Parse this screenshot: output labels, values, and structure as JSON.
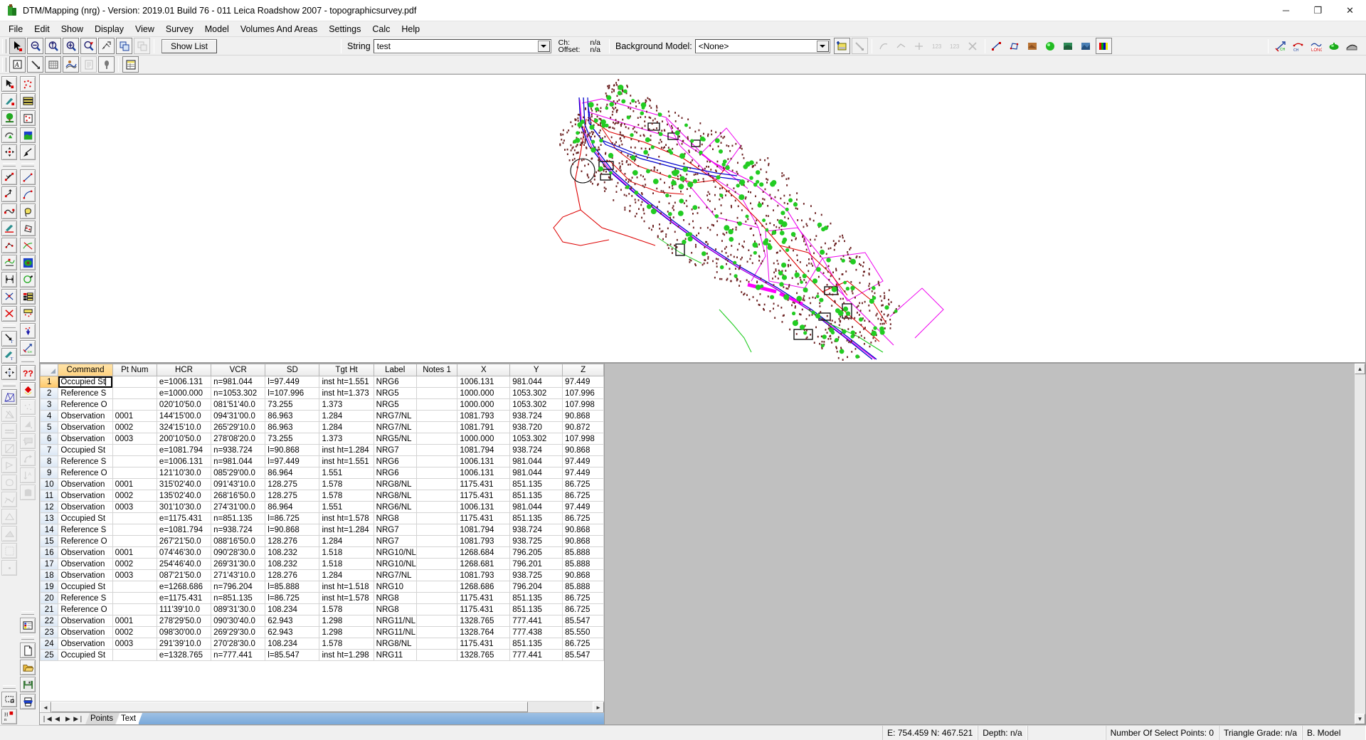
{
  "window": {
    "title": "DTM/Mapping (nrg) - Version: 2019.01 Build 76 - 011 Leica Roadshow 2007 - topographicsurvey.pdf",
    "app_icon": "survey-app-icon",
    "minimize": "─",
    "maximize": "❐",
    "close": "✕"
  },
  "menu": [
    {
      "label": "File"
    },
    {
      "label": "Edit"
    },
    {
      "label": "Show"
    },
    {
      "label": "Display"
    },
    {
      "label": "View"
    },
    {
      "label": "Survey"
    },
    {
      "label": "Model"
    },
    {
      "label": "Volumes And Areas"
    },
    {
      "label": "Settings"
    },
    {
      "label": "Calc"
    },
    {
      "label": "Help"
    }
  ],
  "toolbar": {
    "show_list_label": "Show List",
    "string_label": "String",
    "string_value": "test",
    "ch_label": "Ch:",
    "offset_label": "Offset:",
    "ch_value": "n/a",
    "offset_value": "n/a",
    "background_model_label": "Background Model:",
    "background_model_value": "<None>",
    "icons_row1": [
      "select-arrow-icon",
      "zoom-out-icon",
      "zoom-window-icon",
      "zoom-in-icon",
      "zoom-pan-icon",
      "zoom-extents-icon",
      "tile-windows-icon",
      "cascade-windows-icon"
    ],
    "icons_row2": [
      "text-annotate-icon",
      "pointer-line-icon",
      "grid-icon",
      "contours-icon",
      "report-icon",
      "marker-icon",
      "table-view-icon"
    ],
    "icons_right": [
      "pick-image-icon",
      "pointer-pick-icon",
      "string-edit-icon",
      "string-join-icon",
      "renumber-icon",
      "delete-cross-icon",
      "string-split-icon",
      "polygon-tool-icon",
      "surface-icon",
      "shade-icon",
      "palette-icon",
      "chainage-icon",
      "offset-chainage-icon",
      "long-section-icon",
      "volume-icon",
      "section-icon"
    ]
  },
  "left_toolbar_col1": [
    "select-point-icon",
    "wand-point-icon",
    "tree-point-icon",
    "arc-point-icon",
    "move-point-icon",
    "add-line-point-icon",
    "raise-point-icon",
    "smooth-line-icon",
    "wand-line-icon",
    "points-line-icon",
    "breakline-icon",
    "offset-line-icon",
    "cross-line-icon",
    "delete-line-icon",
    "text-arrow-icon",
    "text-wand-icon",
    "move-text-icon",
    "triangulate-icon",
    "delete-triangle-icon",
    "contour-line-icon",
    "diagonal-swap-icon",
    "flag-triangle-icon",
    "boundary-icon",
    "mesh-edit-icon",
    "hull-icon",
    "shade-triangle-icon",
    "dither-icon",
    "single-point-icon",
    "rectangle-area-icon",
    "volume-area-icon"
  ],
  "left_toolbar_col2": [
    "scatter-points-icon",
    "table-points-icon",
    "box-points-icon",
    "map-fill-icon",
    "pick-arrow-icon",
    "line-points-icon",
    "curve-points-icon",
    "lasso-icon",
    "polygon-points-icon",
    "cross-strings-icon",
    "shaded-model-icon",
    "tree-edit-icon",
    "legend-icon",
    "report-points-icon",
    "station-icon",
    "chainage-arrow-icon",
    "query-icon",
    "paint-bucket-icon",
    "sparse-points-icon",
    "wedge-icon",
    "label-box-icon",
    "rotate-icon",
    "sort-az-icon",
    "fill-shape-icon",
    "properties-icon",
    "new-file-icon",
    "open-file-icon",
    "save-file-icon",
    "print-icon"
  ],
  "grid": {
    "columns": [
      "Command",
      "Pt Num",
      "HCR",
      "VCR",
      "SD",
      "Tgt Ht",
      "Label",
      "Notes 1",
      "X",
      "Y",
      "Z"
    ],
    "active_cell": {
      "row": 1,
      "column": "Command",
      "value": "Occupied St"
    },
    "rows": [
      {
        "n": "1",
        "cells": [
          "Occupied St",
          "",
          "e=1006.131",
          "n=981.044",
          "l=97.449",
          "inst ht=1.551",
          "NRG6",
          "",
          "1006.131",
          "981.044",
          "97.449"
        ]
      },
      {
        "n": "2",
        "cells": [
          "Reference S",
          "",
          "e=1000.000",
          "n=1053.302",
          "l=107.996",
          "inst ht=1.373",
          "NRG5",
          "",
          "1000.000",
          "1053.302",
          "107.996"
        ]
      },
      {
        "n": "3",
        "cells": [
          "Reference O",
          "",
          "020'10'50.0",
          "081'51'40.0",
          "73.255",
          "1.373",
          "NRG5",
          "",
          "1000.000",
          "1053.302",
          "107.998"
        ]
      },
      {
        "n": "4",
        "cells": [
          "Observation",
          "0001",
          "144'15'00.0",
          "094'31'00.0",
          "86.963",
          "1.284",
          "NRG7/NL",
          "",
          "1081.793",
          "938.724",
          "90.868"
        ]
      },
      {
        "n": "5",
        "cells": [
          "Observation",
          "0002",
          "324'15'10.0",
          "265'29'10.0",
          "86.963",
          "1.284",
          "NRG7/NL",
          "",
          "1081.791",
          "938.720",
          "90.872"
        ]
      },
      {
        "n": "6",
        "cells": [
          "Observation",
          "0003",
          "200'10'50.0",
          "278'08'20.0",
          "73.255",
          "1.373",
          "NRG5/NL",
          "",
          "1000.000",
          "1053.302",
          "107.998"
        ]
      },
      {
        "n": "7",
        "cells": [
          "Occupied St",
          "",
          "e=1081.794",
          "n=938.724",
          "l=90.868",
          "inst ht=1.284",
          "NRG7",
          "",
          "1081.794",
          "938.724",
          "90.868"
        ]
      },
      {
        "n": "8",
        "cells": [
          "Reference S",
          "",
          "e=1006.131",
          "n=981.044",
          "l=97.449",
          "inst ht=1.551",
          "NRG6",
          "",
          "1006.131",
          "981.044",
          "97.449"
        ]
      },
      {
        "n": "9",
        "cells": [
          "Reference O",
          "",
          "121'10'30.0",
          "085'29'00.0",
          "86.964",
          "1.551",
          "NRG6",
          "",
          "1006.131",
          "981.044",
          "97.449"
        ]
      },
      {
        "n": "10",
        "cells": [
          "Observation",
          "0001",
          "315'02'40.0",
          "091'43'10.0",
          "128.275",
          "1.578",
          "NRG8/NL",
          "",
          "1175.431",
          "851.135",
          "86.725"
        ]
      },
      {
        "n": "11",
        "cells": [
          "Observation",
          "0002",
          "135'02'40.0",
          "268'16'50.0",
          "128.275",
          "1.578",
          "NRG8/NL",
          "",
          "1175.431",
          "851.135",
          "86.725"
        ]
      },
      {
        "n": "12",
        "cells": [
          "Observation",
          "0003",
          "301'10'30.0",
          "274'31'00.0",
          "86.964",
          "1.551",
          "NRG6/NL",
          "",
          "1006.131",
          "981.044",
          "97.449"
        ]
      },
      {
        "n": "13",
        "cells": [
          "Occupied St",
          "",
          "e=1175.431",
          "n=851.135",
          "l=86.725",
          "inst ht=1.578",
          "NRG8",
          "",
          "1175.431",
          "851.135",
          "86.725"
        ]
      },
      {
        "n": "14",
        "cells": [
          "Reference S",
          "",
          "e=1081.794",
          "n=938.724",
          "l=90.868",
          "inst ht=1.284",
          "NRG7",
          "",
          "1081.794",
          "938.724",
          "90.868"
        ]
      },
      {
        "n": "15",
        "cells": [
          "Reference O",
          "",
          "267'21'50.0",
          "088'16'50.0",
          "128.276",
          "1.284",
          "NRG7",
          "",
          "1081.793",
          "938.725",
          "90.868"
        ]
      },
      {
        "n": "16",
        "cells": [
          "Observation",
          "0001",
          "074'46'30.0",
          "090'28'30.0",
          "108.232",
          "1.518",
          "NRG10/NL",
          "",
          "1268.684",
          "796.205",
          "85.888"
        ]
      },
      {
        "n": "17",
        "cells": [
          "Observation",
          "0002",
          "254'46'40.0",
          "269'31'30.0",
          "108.232",
          "1.518",
          "NRG10/NL",
          "",
          "1268.681",
          "796.201",
          "85.888"
        ]
      },
      {
        "n": "18",
        "cells": [
          "Observation",
          "0003",
          "087'21'50.0",
          "271'43'10.0",
          "128.276",
          "1.284",
          "NRG7/NL",
          "",
          "1081.793",
          "938.725",
          "90.868"
        ]
      },
      {
        "n": "19",
        "cells": [
          "Occupied St",
          "",
          "e=1268.686",
          "n=796.204",
          "l=85.888",
          "inst ht=1.518",
          "NRG10",
          "",
          "1268.686",
          "796.204",
          "85.888"
        ]
      },
      {
        "n": "20",
        "cells": [
          "Reference S",
          "",
          "e=1175.431",
          "n=851.135",
          "l=86.725",
          "inst ht=1.578",
          "NRG8",
          "",
          "1175.431",
          "851.135",
          "86.725"
        ]
      },
      {
        "n": "21",
        "cells": [
          "Reference O",
          "",
          "111'39'10.0",
          "089'31'30.0",
          "108.234",
          "1.578",
          "NRG8",
          "",
          "1175.431",
          "851.135",
          "86.725"
        ]
      },
      {
        "n": "22",
        "cells": [
          "Observation",
          "0001",
          "278'29'50.0",
          "090'30'40.0",
          "62.943",
          "1.298",
          "NRG11/NL",
          "",
          "1328.765",
          "777.441",
          "85.547"
        ]
      },
      {
        "n": "23",
        "cells": [
          "Observation",
          "0002",
          "098'30'00.0",
          "269'29'30.0",
          "62.943",
          "1.298",
          "NRG11/NL",
          "",
          "1328.764",
          "777.438",
          "85.550"
        ]
      },
      {
        "n": "24",
        "cells": [
          "Observation",
          "0003",
          "291'39'10.0",
          "270'28'30.0",
          "108.234",
          "1.578",
          "NRG8/NL",
          "",
          "1175.431",
          "851.135",
          "86.725"
        ]
      },
      {
        "n": "25",
        "cells": [
          "Occupied St",
          "",
          "e=1328.765",
          "n=777.441",
          "l=85.547",
          "inst ht=1.298",
          "NRG11",
          "",
          "1328.765",
          "777.441",
          "85.547"
        ]
      }
    ]
  },
  "sheet_tabs": {
    "nav": [
      "❘◀",
      "◀",
      "▶",
      "▶❘"
    ],
    "tabs": [
      {
        "label": "Points",
        "active": false
      },
      {
        "label": "Text",
        "active": true
      }
    ]
  },
  "status": {
    "coords": "E: 754.459  N: 467.521",
    "depth": "Depth: n/a",
    "select_points": "Number Of Select Points: 0",
    "triangle_grade": "Triangle Grade: n/a",
    "b_model": "B. Model"
  },
  "colors": {
    "accent_orange": "#ffc96a",
    "grid_header": "#f0f0f0",
    "map_points": "#6b2020",
    "map_trees": "#22cc22",
    "map_roads_blue": "#0000cc",
    "map_boundary_red": "#dd0000",
    "map_magenta": "#ee00ee",
    "titlebar": "#ffffff",
    "chrome": "#f0f0f0"
  }
}
